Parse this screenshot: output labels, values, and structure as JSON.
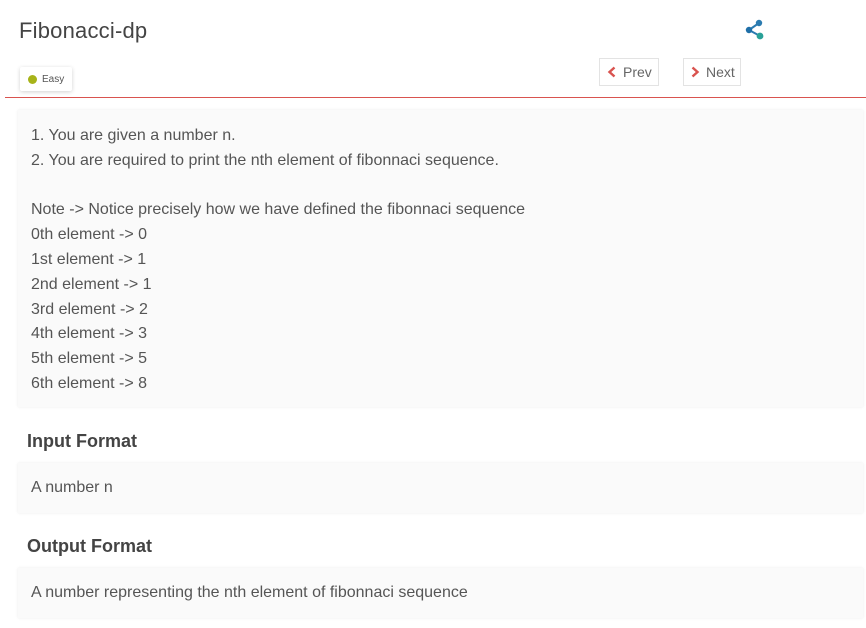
{
  "problem": {
    "title": "Fibonacci-dp",
    "difficulty": "Easy",
    "colors": {
      "difficulty_dot": "#a7b319",
      "accent": "#d9534f",
      "share": "#2aa198"
    }
  },
  "nav": {
    "prev_label": "Prev",
    "next_label": "Next"
  },
  "description": {
    "lines": [
      "1. You are given a number n.",
      "2. You are required to print the nth element of fibonnaci sequence.",
      "",
      "Note -> Notice precisely how we have defined the fibonnaci sequence",
      "0th element -> 0",
      "1st element -> 1",
      "2nd element -> 1",
      "3rd element -> 2",
      "4th element -> 3",
      "5th element -> 5",
      "6th element -> 8"
    ]
  },
  "input_format": {
    "heading": "Input Format",
    "text": "A number n"
  },
  "output_format": {
    "heading": "Output Format",
    "text": "A number representing the nth element of fibonnaci sequence"
  }
}
